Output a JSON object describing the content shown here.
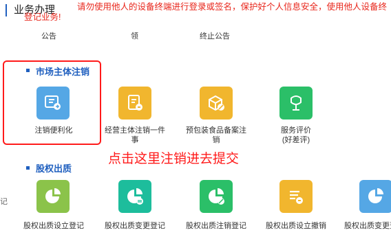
{
  "header": {
    "title": "业务办理",
    "warning_line1": "请勿使用他人的设备终端进行登录或签名，保护好个人信息安全，使用他人设备终",
    "warning_line2": "登记业务!"
  },
  "top_row": [
    {
      "label": "公告"
    },
    {
      "label": "领"
    },
    {
      "label": "终止公告"
    }
  ],
  "sections": {
    "market_entity_deregistration": {
      "title": "市场主体注销",
      "items": [
        {
          "label": "注销便利化",
          "icon": "deregister-convenience-icon",
          "color": "#55a7e5"
        },
        {
          "label_lines": [
            "经营主体注销一件",
            "事"
          ],
          "icon": "business-deregister-icon",
          "color": "#f1b62e"
        },
        {
          "label_lines": [
            "预包装食品备案注",
            "销"
          ],
          "icon": "food-filing-deregister-icon",
          "color": "#f1b62e"
        },
        {
          "label_lines": [
            "服务评价",
            "(好差评)"
          ],
          "icon": "service-evaluation-icon",
          "color": "#2bbf68"
        }
      ]
    },
    "equity_pledge": {
      "title": "股权出质",
      "items": [
        {
          "label": "股权出质设立登记",
          "icon": "pledge-setup-icon",
          "color": "#8bc34a"
        },
        {
          "label": "股权出质变更登记",
          "icon": "pledge-change-icon",
          "color": "#1dbd9c"
        },
        {
          "label": "股权出质注销登记",
          "icon": "pledge-deregister-icon",
          "color": "#2bbf68"
        },
        {
          "label": "股权出质设立撤销",
          "icon": "pledge-revoke-icon",
          "color": "#f1b62e"
        },
        {
          "label": "股权出质变更登",
          "icon": "pledge-change-registration-icon",
          "color": "#55a7e5"
        }
      ]
    }
  },
  "annotation": "点击这里注销进去提交",
  "left_edge_text": "记"
}
